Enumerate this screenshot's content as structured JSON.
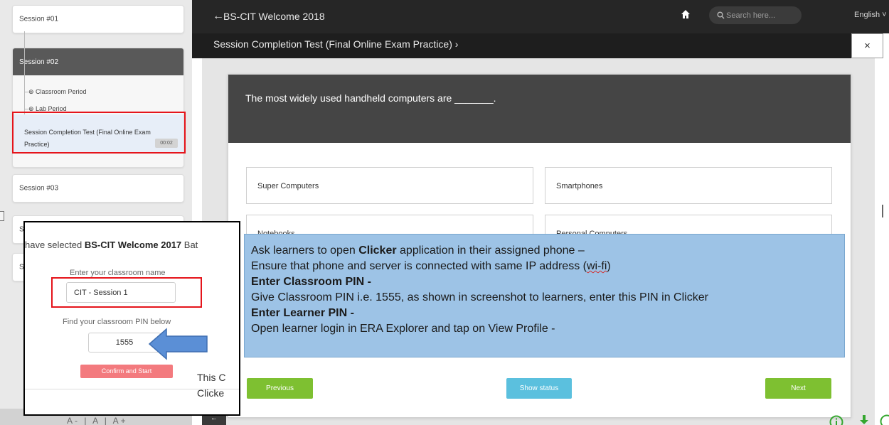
{
  "header": {
    "title": "BS-CIT Welcome 2018",
    "search_placeholder": "Search here...",
    "language": "English ˅"
  },
  "breadcrumb": {
    "text": "Session Completion Test (Final Online Exam Practice) ›",
    "close": "×"
  },
  "sidebar": {
    "sessions": [
      "Session #01",
      "Session #02",
      "Session #03",
      "S",
      "S"
    ],
    "sub_items": [
      {
        "label": "⊕ Classroom Period"
      },
      {
        "label": "⊕ Lab Period"
      },
      {
        "label": "Session Completion Test (Final Online Exam Practice)",
        "time": "00:02"
      }
    ],
    "font_controls": "A- | A | A+"
  },
  "quiz": {
    "question": "The most widely used handheld computers are _______.",
    "options": [
      "Super Computers",
      "Smartphones",
      "Notebooks",
      "Personal Computers"
    ],
    "prev": "Previous",
    "status": "Show status",
    "next": "Next"
  },
  "inset": {
    "selected_prefix": "have selected ",
    "selected_bold": "BS-CIT Welcome 2017",
    "selected_suffix": " Bat",
    "name_label": "Enter your classroom name",
    "name_value": "CIT - Session 1",
    "pin_label": "Find your classroom PIN below",
    "pin_value": "1555",
    "confirm": "Confirm and Start"
  },
  "trailing_text": {
    "line1": "This C",
    "line2": "Clicke"
  },
  "callout": {
    "line1_a": "Ask learners to open ",
    "line1_b": "Clicker",
    "line1_c": " application in their assigned phone –",
    "line2_a": "Ensure that phone and server is connected with same IP address (",
    "line2_b": "wi-fi",
    "line2_c": ")",
    "line3": "Enter Classroom PIN -",
    "line4": "Give Classroom PIN i.e. 1555, as shown in screenshot to learners, enter this PIN in Clicker",
    "line5": "Enter Learner PIN -",
    "line6": "Open learner login in ERA Explorer and tap on View Profile -"
  },
  "colors": {
    "highlight_red": "#e5141b",
    "callout_blue": "#9dc3e6",
    "arrow_blue": "#5b8fd6",
    "button_green": "#7ec031",
    "button_cyan": "#5bc0de",
    "confirm_pink": "#f37a7e"
  },
  "icons": [
    "back-arrow-icon",
    "home-icon",
    "search-icon",
    "close-icon",
    "info-icon",
    "download-icon",
    "more-icon",
    "pointer-arrow-icon"
  ]
}
